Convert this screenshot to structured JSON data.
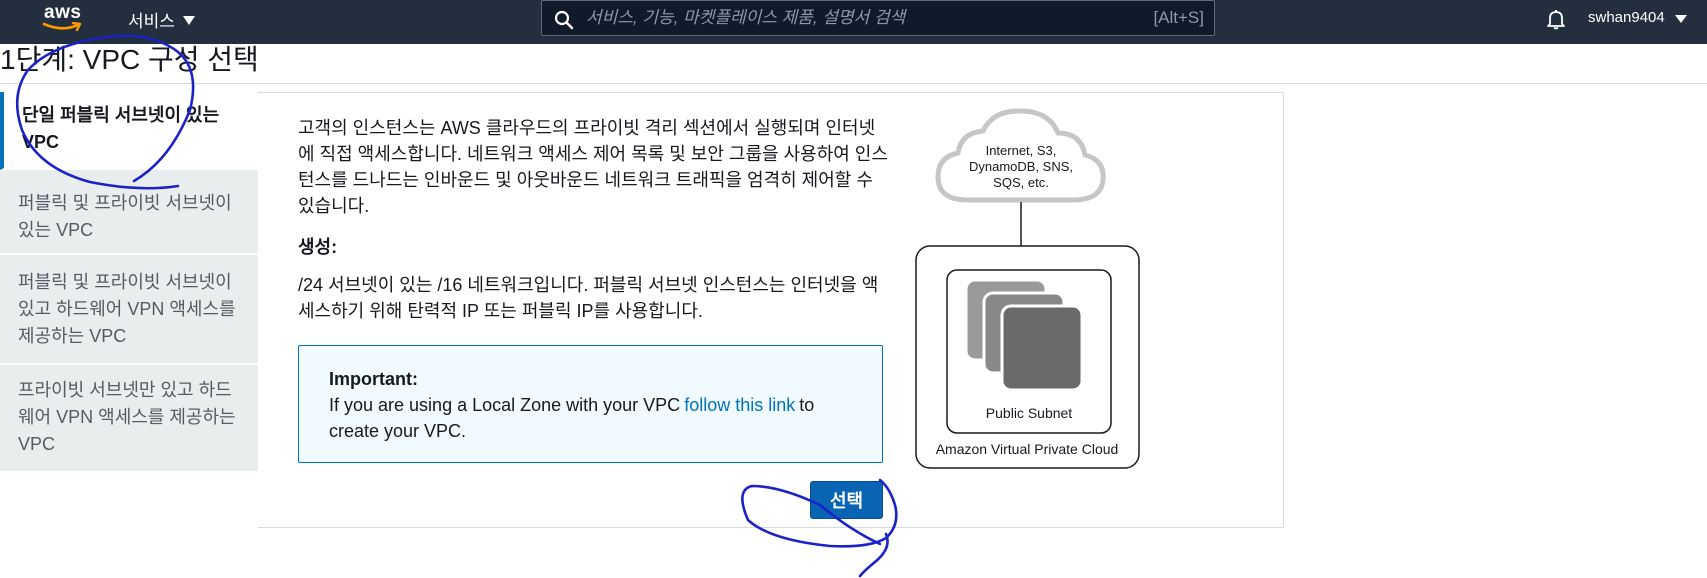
{
  "nav": {
    "logo_text": "aws",
    "services_label": "서비스",
    "search_placeholder": "서비스, 기능, 마켓플레이스 제품, 설명서 검색",
    "search_shortcut": "[Alt+S]",
    "username": "swhan9404"
  },
  "page": {
    "title": "1단계: VPC 구성 선택"
  },
  "tabs": [
    {
      "label": "단일 퍼블릭 서브넷이 있는 VPC",
      "active": true
    },
    {
      "label": "퍼블릭 및 프라이빗 서브넷이 있는 VPC",
      "active": false
    },
    {
      "label": "퍼블릭 및 프라이빗 서브넷이 있고 하드웨어 VPN 액세스를 제공하는 VPC",
      "active": false
    },
    {
      "label": "프라이빗 서브넷만 있고 하드웨어 VPN 액세스를 제공하는 VPC",
      "active": false
    }
  ],
  "content": {
    "description": "고객의 인스턴스는 AWS 클라우드의 프라이빗 격리 섹션에서 실행되며 인터넷에 직접 액세스합니다. 네트워크 액세스 제어 목록 및 보안 그룹을 사용하여 인스턴스를 드나드는 인바운드 및 아웃바운드 네트워크 트래픽을 엄격히 제어할 수 있습니다.",
    "creates_label": "생성:",
    "creates_description": "/24 서브넷이 있는 /16 네트워크입니다. 퍼블릭 서브넷 인스턴스는 인터넷을 액세스하기 위해 탄력적 IP 또는 퍼블릭 IP를 사용합니다.",
    "important": {
      "title": "Important:",
      "text_before": "If you are using a Local Zone with your VPC",
      "link": "follow this link",
      "text_after": "to create your VPC."
    },
    "select_button": "선택"
  },
  "diagram": {
    "cloud_line1": "Internet, S3,",
    "cloud_line2": "DynamoDB, SNS,",
    "cloud_line3": "SQS, etc.",
    "subnet_label": "Public Subnet",
    "vpc_label": "Amazon Virtual Private Cloud"
  },
  "colors": {
    "nav_bg": "#232f3e",
    "accent": "#0073bb",
    "button_bg": "#0a64b4",
    "ink": "#1a22c8"
  }
}
